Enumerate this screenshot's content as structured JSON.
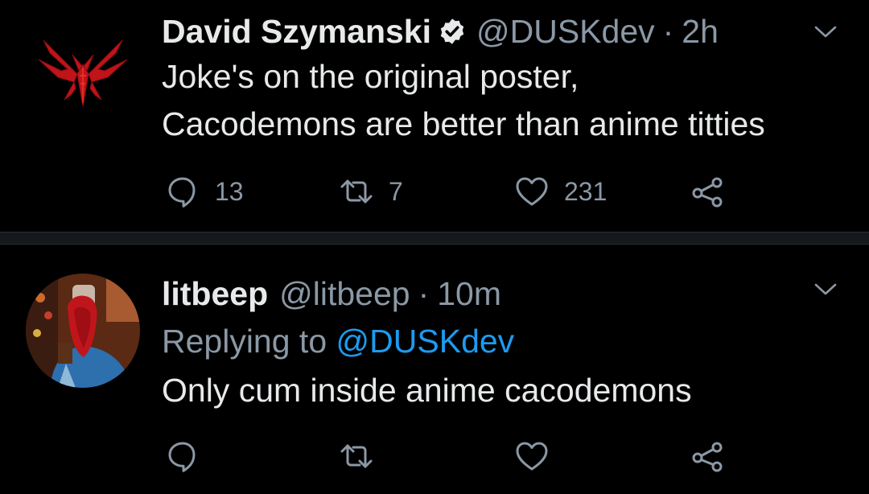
{
  "colors": {
    "background": "#000000",
    "divider": "#15181c",
    "text_primary": "#e7e9ea",
    "text_secondary": "#8b98a5",
    "link": "#1d9bf0",
    "verified_badge": "#e7e9ea"
  },
  "tweets": [
    {
      "display_name": "David Szymanski",
      "verified": true,
      "handle": "@DUSKdev",
      "separator": "·",
      "time": "2h",
      "avatar_icon": "red-demon-sigil",
      "text_lines": [
        "Joke's on the original poster,",
        "Cacodemons are better than anime titties"
      ],
      "actions": {
        "reply_count": "13",
        "retweet_count": "7",
        "like_count": "231"
      }
    },
    {
      "display_name": "litbeep",
      "verified": false,
      "handle": "@litbeep",
      "separator": "·",
      "time": "10m",
      "avatar_icon": "user-photo",
      "replying_to_label": "Replying to",
      "replying_to_handle": "@DUSKdev",
      "text_lines": [
        "Only cum inside anime cacodemons"
      ],
      "actions": {
        "reply_count": "",
        "retweet_count": "",
        "like_count": ""
      }
    }
  ]
}
